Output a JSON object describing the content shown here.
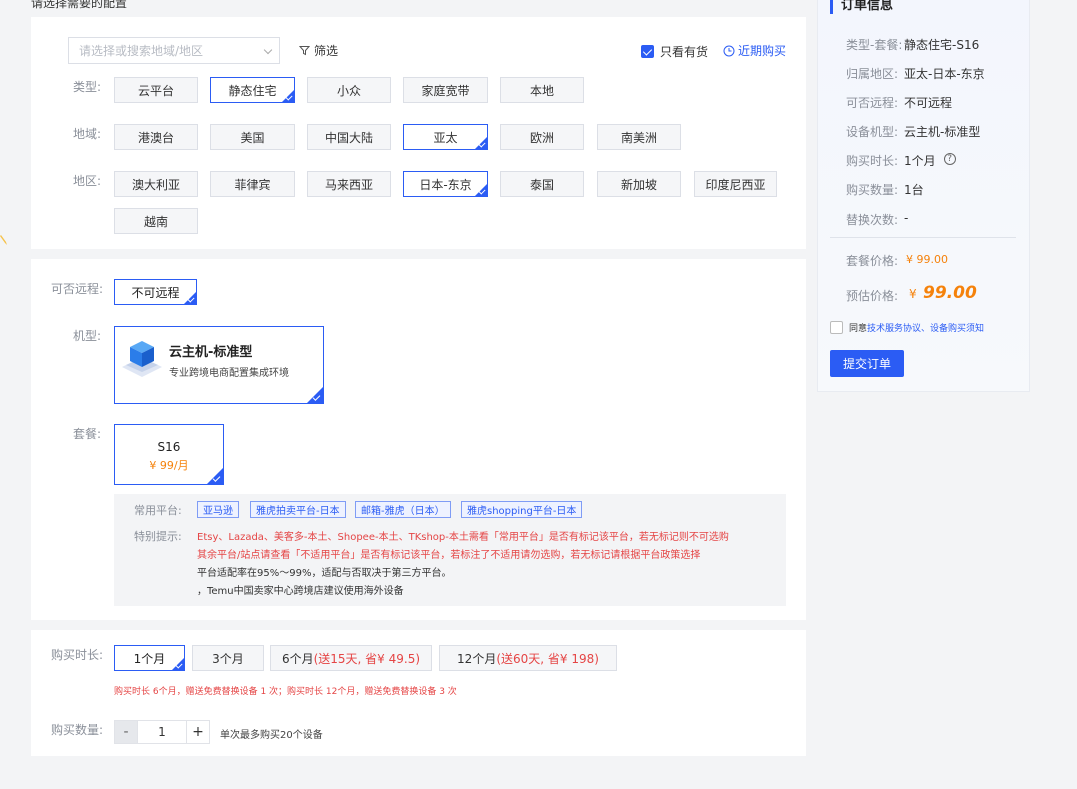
{
  "header": {
    "cut_title": "请选择需要的配置"
  },
  "filters": {
    "search_placeholder": "请选择或搜索地域/地区",
    "filter_label": "筛选",
    "in_stock_label": "只看有货",
    "in_stock_checked": true,
    "recent_label": "近期购买"
  },
  "type": {
    "label": "类型:",
    "options": [
      "云平台",
      "静态住宅",
      "小众",
      "家庭宽带",
      "本地"
    ],
    "selected": "静态住宅"
  },
  "region": {
    "label": "地域:",
    "options": [
      "港澳台",
      "美国",
      "中国大陆",
      "亚太",
      "欧洲",
      "南美洲"
    ],
    "selected": "亚太"
  },
  "area": {
    "label": "地区:",
    "options": [
      "澳大利亚",
      "菲律宾",
      "马来西亚",
      "日本-东京",
      "泰国",
      "新加坡",
      "印度尼西亚",
      "越南"
    ],
    "selected": "日本-东京"
  },
  "remote": {
    "label": "可否远程:",
    "option": "不可远程"
  },
  "model": {
    "label": "机型:",
    "name": "云主机-标准型",
    "desc": "专业跨境电商配置集成环境",
    "icon": "cube-server-icon"
  },
  "package": {
    "label": "套餐:",
    "name": "S16",
    "price": "¥ 99/月"
  },
  "info": {
    "platform_label": "常用平台:",
    "platforms": [
      "亚马逊",
      "雅虎拍卖平台-日本",
      "邮箱-雅虎（日本）",
      "雅虎shopping平台-日本"
    ],
    "tip_label": "特别提示:",
    "tip_line1": "Etsy、Lazada、美客多-本土、Shopee-本土、TKshop-本土需看「常用平台」是否有标记该平台，若无标记则不可选购",
    "tip_line2": "其余平台/站点请查看「不适用平台」是否有标记该平台，若标注了不适用请勿选购，若无标记请根据平台政策选择",
    "tip_line3": "平台适配率在95%～99%，适配与否取决于第三方平台。",
    "tip_line4": "，Temu中国卖家中心跨境店建议使用海外设备"
  },
  "duration": {
    "label": "购买时长:",
    "options": [
      {
        "main": "1个月",
        "extra": ""
      },
      {
        "main": "3个月",
        "extra": ""
      },
      {
        "main": "6个月",
        "extra": "(送15天, 省¥ 49.5)"
      },
      {
        "main": "12个月",
        "extra": "(送60天, 省¥ 198)"
      }
    ],
    "selected": "1个月",
    "note": "购买时长 6个月，赠送免费替换设备 1 次；购买时长 12个月，赠送免费替换设备 3 次"
  },
  "quantity": {
    "label": "购买数量:",
    "minus": "-",
    "value": "1",
    "plus": "+",
    "note": "单次最多购买20个设备"
  },
  "order": {
    "title": "订单信息",
    "rows": [
      {
        "k": "类型-套餐:",
        "v": "静态住宅-S16"
      },
      {
        "k": "归属地区:",
        "v": "亚太-日本-东京"
      },
      {
        "k": "可否远程:",
        "v": "不可远程"
      },
      {
        "k": "设备机型:",
        "v": "云主机-标准型"
      },
      {
        "k": "购买时长:",
        "v": "1个月"
      },
      {
        "k": "购买数量:",
        "v": "1台"
      },
      {
        "k": "替换次数:",
        "v": "-"
      }
    ],
    "package_price_label": "套餐价格:",
    "package_price": "¥ 99.00",
    "est_price_label": "预估价格:",
    "est_currency": "¥",
    "est_price": "99.00",
    "agree_prefix": "同意",
    "agree_link1": "技术服务协议",
    "agree_sep": "、",
    "agree_link2": "设备购买须知",
    "submit": "提交订单"
  },
  "colors": {
    "accent": "#2b5cf4",
    "price": "#f5820b",
    "warn": "#e54545"
  }
}
